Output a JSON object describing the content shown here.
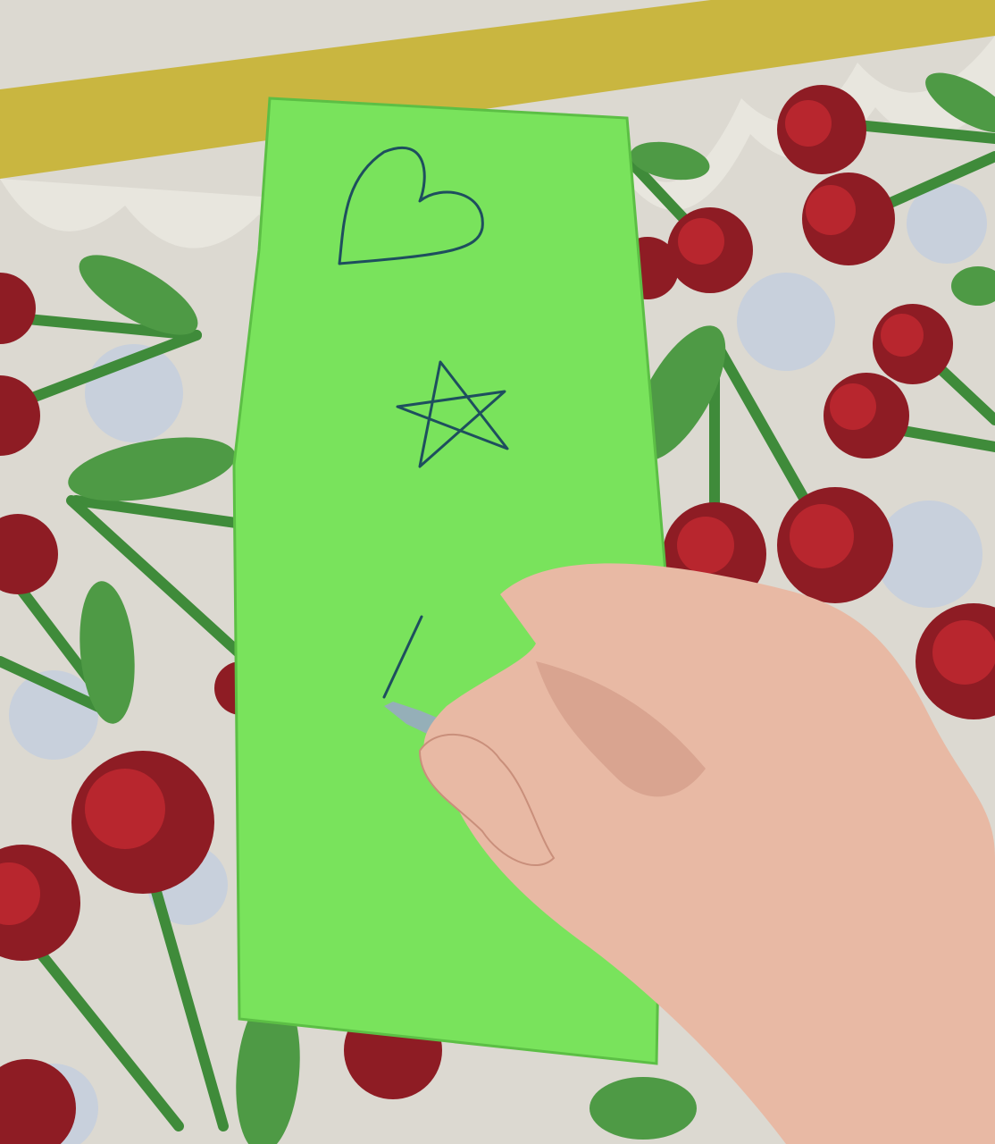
{
  "scene": {
    "tablecloth": {
      "background": "#dcd9d1",
      "border_band": "#c9b640",
      "scallop": "#e8e6de",
      "cherry": "#b8262e",
      "cherry_shade": "#8e1c24",
      "stem": "#3f8b3a",
      "leaf": "#4e9a45",
      "dot": "#c8d0dc"
    },
    "paper": {
      "color": "#79e35c",
      "edge": "#5cbf45"
    },
    "drawings": {
      "ink": "#1e4f5e",
      "shapes": [
        "heart",
        "star",
        "line"
      ]
    },
    "hand": {
      "skin": "#e8b9a4",
      "shadow": "#c98f7b"
    },
    "pen": {
      "barrel": "#9aa6c8",
      "cap": "#2a3fc9"
    }
  }
}
